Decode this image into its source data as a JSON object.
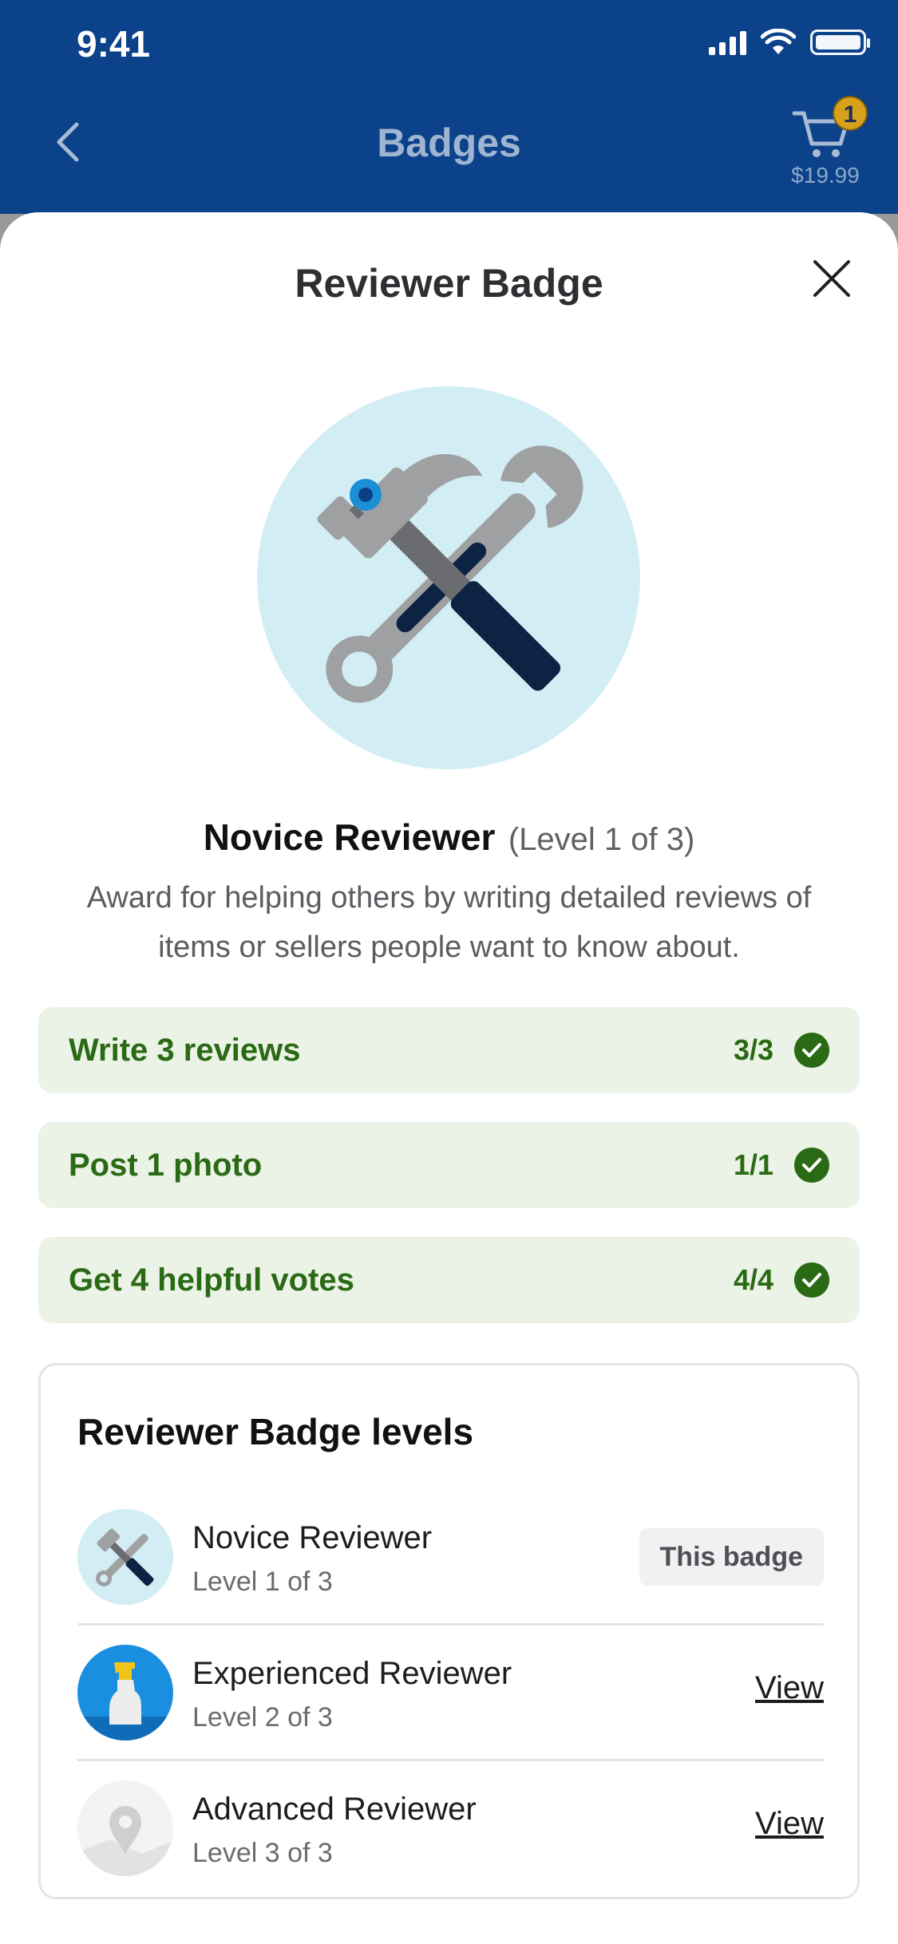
{
  "status_bar": {
    "time": "9:41"
  },
  "nav": {
    "title": "Badges",
    "cart_count": "1",
    "cart_price": "$19.99"
  },
  "sheet": {
    "title": "Reviewer Badge",
    "badge_name": "Novice Reviewer",
    "badge_level": "(Level 1 of 3)",
    "description": "Award for helping others by writing detailed reviews of items or sellers people want to know about.",
    "tasks": [
      {
        "label": "Write 3 reviews",
        "count": "3/3"
      },
      {
        "label": "Post 1 photo",
        "count": "1/1"
      },
      {
        "label": "Get 4 helpful votes",
        "count": "4/4"
      }
    ],
    "levels": {
      "title": "Reviewer Badge levels",
      "items": [
        {
          "name": "Novice Reviewer",
          "sub": "Level 1 of 3",
          "action": "This badge"
        },
        {
          "name": "Experienced Reviewer",
          "sub": "Level 2 of 3",
          "action": "View"
        },
        {
          "name": "Advanced Reviewer",
          "sub": "Level 3 of 3",
          "action": "View"
        }
      ]
    }
  },
  "colors": {
    "nav_blue": "#0b4289",
    "success_green": "#2a6a14",
    "task_bg": "#eaf3e6",
    "hero_bg": "#d3edf5"
  }
}
